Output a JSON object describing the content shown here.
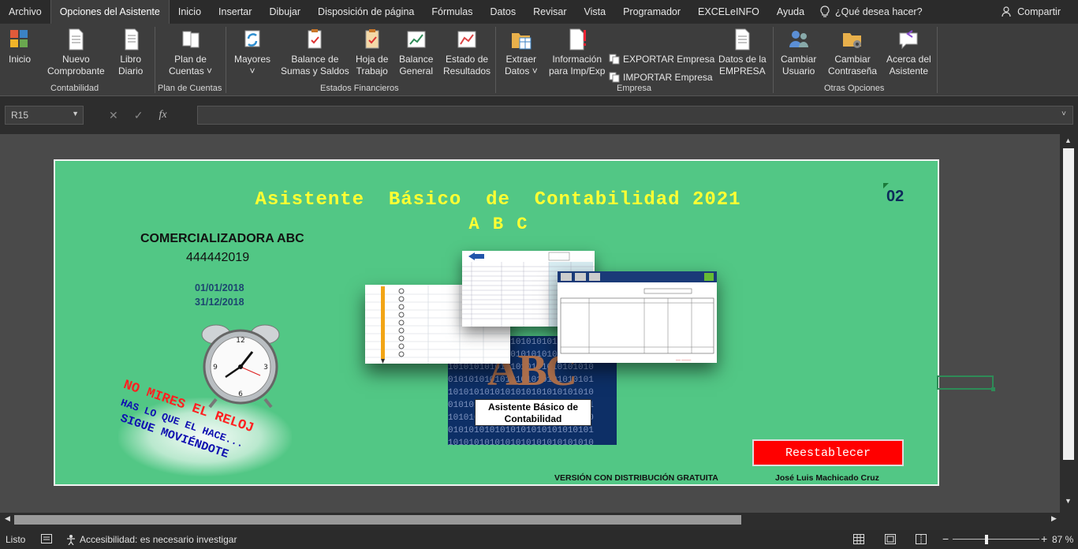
{
  "menu": {
    "tabs": [
      "Archivo",
      "Opciones del Asistente",
      "Inicio",
      "Insertar",
      "Dibujar",
      "Disposición de página",
      "Fórmulas",
      "Datos",
      "Revisar",
      "Vista",
      "Programador",
      "EXCELeINFO",
      "Ayuda"
    ],
    "active_tab": "Opciones del Asistente",
    "tell_me": "¿Qué desea hacer?",
    "share": "Compartir"
  },
  "ribbon": {
    "inicio": "Inicio",
    "nuevo_comprobante": [
      "Nuevo",
      "Comprobante"
    ],
    "libro_diario": [
      "Libro",
      "Diario"
    ],
    "plan_de_cuentas": [
      "Plan de",
      "Cuentas"
    ],
    "mayores": "Mayores",
    "balance_sumas": [
      "Balance de",
      "Sumas y Saldos"
    ],
    "hoja_trabajo": [
      "Hoja de",
      "Trabajo"
    ],
    "balance_general": [
      "Balance",
      "General"
    ],
    "estado_resultados": [
      "Estado de",
      "Resultados"
    ],
    "extraer_datos": [
      "Extraer",
      "Datos"
    ],
    "informacion": [
      "Información",
      "para Imp/Exp"
    ],
    "exportar": "EXPORTAR Empresa",
    "importar": "IMPORTAR Empresa",
    "datos_empresa": [
      "Datos de la",
      "EMPRESA"
    ],
    "cambiar_usuario": [
      "Cambiar",
      "Usuario"
    ],
    "cambiar_contrasena": [
      "Cambiar",
      "Contraseña"
    ],
    "acerca": [
      "Acerca del",
      "Asistente"
    ],
    "groups": {
      "contabilidad": "Contabilidad",
      "plan": "Plan de Cuentas",
      "estados": "Estados Financieros",
      "empresa": "Empresa",
      "otras": "Otras Opciones"
    }
  },
  "formula_bar": {
    "name_box": "R15",
    "fx": "fx",
    "formula": ""
  },
  "dashboard": {
    "title": "Asistente  Básico  de  Contabilidad 2021",
    "subtitle": "A B C",
    "code": "02",
    "company": "COMERCIALIZADORA ABC",
    "ruc": "444442019",
    "date_start": "01/01/2018",
    "date_end": "31/12/2018",
    "slogan_line1": "NO MIRES EL RELOJ",
    "slogan_line2": "HAS LO QUE EL HACE...",
    "slogan_line3": "SIGUE MOVIÉNDOTE",
    "logo_text": "ABC",
    "logo_label_1": "Asistente Básico de",
    "logo_label_2": "Contabilidad",
    "reset_button": "Reestablecer",
    "version": "VERSIÓN CON DISTRIBUCIÓN GRATUITA",
    "author": "José Luis Machicado Cruz"
  },
  "status": {
    "ready": "Listo",
    "accessibility": "Accesibilidad: es necesario investigar",
    "zoom": "87 %"
  }
}
